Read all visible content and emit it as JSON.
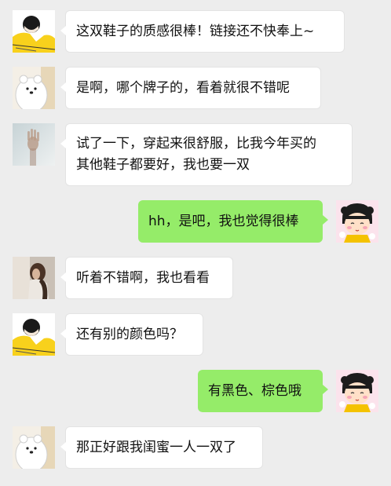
{
  "chat": {
    "messages": [
      {
        "side": "left",
        "avatar": "yellow-girl-avatar",
        "text": "这双鞋子的质感很棒！链接还不快奉上~"
      },
      {
        "side": "left",
        "avatar": "white-bear-avatar",
        "text": "是啊，哪个牌子的，看着就很不错呢"
      },
      {
        "side": "left",
        "avatar": "hand-on-glass-avatar",
        "text": "试了一下，穿起来很舒服，比我今年买的\n其他鞋子都要好，我也要一双"
      },
      {
        "side": "right",
        "avatar": "cartoon-girl-avatar",
        "text": "hh，是吧，我也觉得很棒"
      },
      {
        "side": "left",
        "avatar": "photo-girl-avatar",
        "text": "听着不错啊，我也看看"
      },
      {
        "side": "left",
        "avatar": "yellow-girl-avatar",
        "text": "还有别的颜色吗？"
      },
      {
        "side": "right",
        "avatar": "cartoon-girl-avatar",
        "text": "有黑色、棕色哦"
      },
      {
        "side": "left",
        "avatar": "white-bear-avatar",
        "text": "那正好跟我闺蜜一人一双了"
      }
    ]
  },
  "colors": {
    "background": "#ededed",
    "incoming_bubble": "#ffffff",
    "outgoing_bubble": "#95ec69",
    "text": "#111111"
  }
}
